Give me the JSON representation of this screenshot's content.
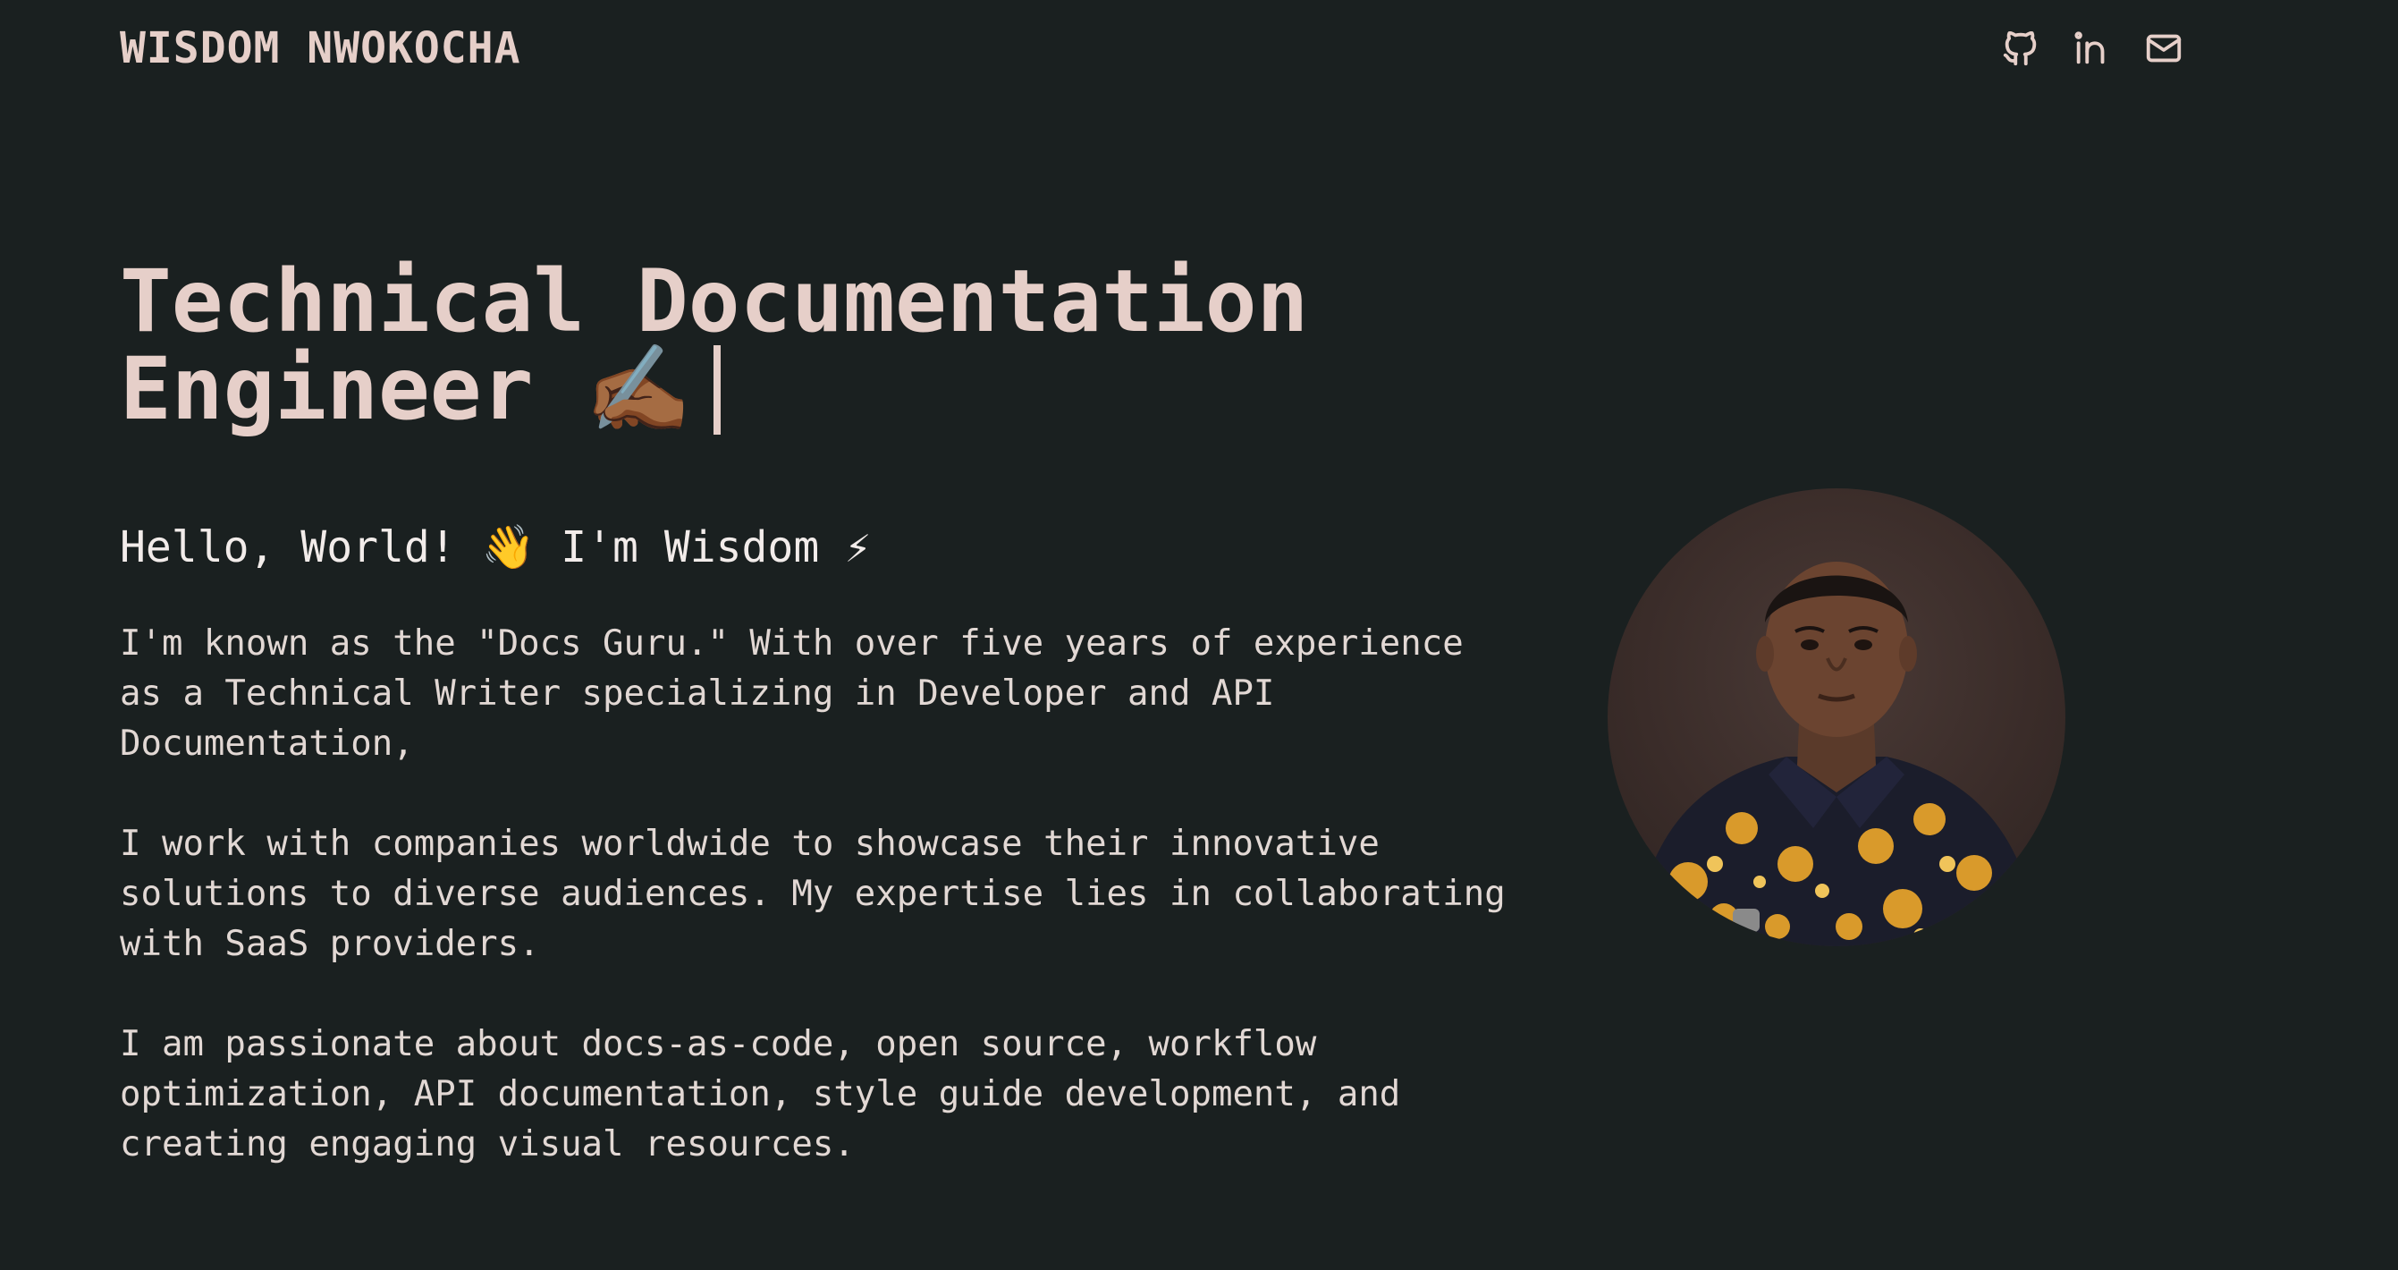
{
  "header": {
    "brand": "WISDOM NWOKOCHA",
    "social_icons": [
      "github-icon",
      "linkedin-icon",
      "mail-icon"
    ]
  },
  "hero": {
    "title_line1": "Technical Documentation",
    "title_line2": "Engineer",
    "title_emoji": "✍🏾",
    "greeting": "Hello, World! 👋 I'm Wisdom ⚡",
    "paragraphs": [
      "I'm known as the \"Docs Guru.\" With over five years of experience as a Technical Writer specializing in Developer and API Documentation,",
      "I work with companies worldwide to showcase their innovative solutions to diverse audiences. My expertise lies in collaborating with SaaS providers.",
      "I am passionate about docs-as-code, open source, workflow optimization, API documentation, style guide development, and creating engaging visual resources."
    ]
  },
  "colors": {
    "background": "#1a2020",
    "heading": "#e6cfc9",
    "text": "#e2d8d4"
  }
}
